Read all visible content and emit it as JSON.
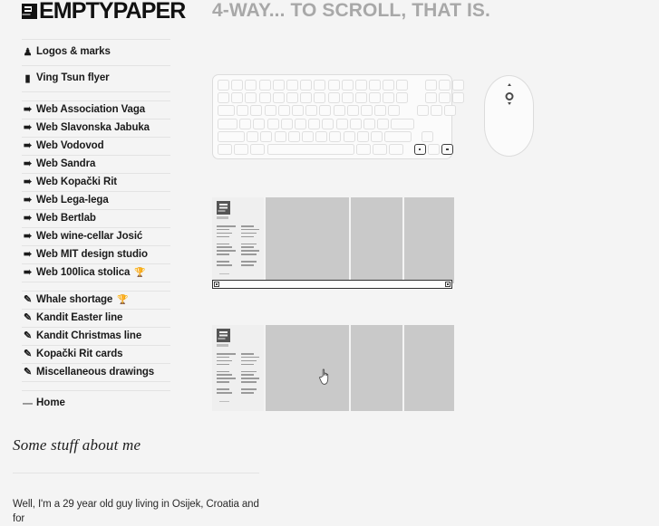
{
  "site": {
    "brand": "EMPTYPAPER",
    "logo_icon": "document-logo-icon"
  },
  "sidebar": {
    "groups": [
      {
        "items": [
          {
            "label": "Logos & marks",
            "icon": "person-bust-icon",
            "badge": ""
          },
          {
            "label": "Ving Tsun flyer",
            "icon": "document-icon",
            "badge": ""
          }
        ]
      },
      {
        "items": [
          {
            "label": "Web Association Vaga",
            "icon": "cursor-arrow-icon",
            "badge": ""
          },
          {
            "label": "Web Slavonska Jabuka",
            "icon": "cursor-arrow-icon",
            "badge": ""
          },
          {
            "label": "Web Vodovod",
            "icon": "cursor-arrow-icon",
            "badge": ""
          },
          {
            "label": "Web Sandra",
            "icon": "cursor-arrow-icon",
            "badge": ""
          },
          {
            "label": "Web Kopački Rit",
            "icon": "cursor-arrow-icon",
            "badge": ""
          },
          {
            "label": "Web Lega-lega",
            "icon": "cursor-arrow-icon",
            "badge": ""
          },
          {
            "label": "Web Bertlab",
            "icon": "cursor-arrow-icon",
            "badge": ""
          },
          {
            "label": "Web wine-cellar Josić",
            "icon": "cursor-arrow-icon",
            "badge": ""
          },
          {
            "label": "Web MIT design studio",
            "icon": "cursor-arrow-icon",
            "badge": ""
          },
          {
            "label": "Web 100lica stolica",
            "icon": "cursor-arrow-icon",
            "badge": " "
          }
        ]
      },
      {
        "items": [
          {
            "label": "Whale shortage",
            "icon": "pencil-icon",
            "badge": " "
          },
          {
            "label": "Kandit Easter line",
            "icon": "pencil-icon",
            "badge": ""
          },
          {
            "label": "Kandit Christmas line",
            "icon": "pencil-icon",
            "badge": ""
          },
          {
            "label": "Kopački Rit cards",
            "icon": "pencil-icon",
            "badge": ""
          },
          {
            "label": "Miscellaneous drawings",
            "icon": "pencil-icon",
            "badge": ""
          }
        ]
      }
    ],
    "home": {
      "label": "Home",
      "marker": "—"
    },
    "about": {
      "title": "Some stuff about me",
      "body": "Well, I'm a 29 year old guy living in Osijek, Croatia and for"
    }
  },
  "main": {
    "title": "4-WAY... TO SCROLL, THAT IS.",
    "keyboard": {
      "name": "keyboard-illustration",
      "highlighted_keys": [
        "arrow-left",
        "arrow-right"
      ]
    },
    "mouse": {
      "name": "mouse-illustration",
      "scroll_control": "scroll-ball"
    },
    "scrollbar": {
      "orientation": "horizontal",
      "left_button": "scroll-left-arrow",
      "right_button": "scroll-right-arrow"
    },
    "galleries": [
      {
        "name": "gallery-row-top",
        "panels": [
          "site-thumbnail",
          "blank-panel",
          "blank-panel",
          "blank-panel"
        ]
      },
      {
        "name": "gallery-row-bottom",
        "panels": [
          "site-thumbnail",
          "blank-panel",
          "blank-panel",
          "blank-panel"
        ]
      }
    ]
  },
  "cursor": {
    "type": "pointing-hand"
  },
  "colors": {
    "background": "#f4f4f4",
    "panel": "#c9c9c9",
    "title": "#a8a8a8",
    "text": "#1a1a1a",
    "rule": "#e3e3e3"
  }
}
